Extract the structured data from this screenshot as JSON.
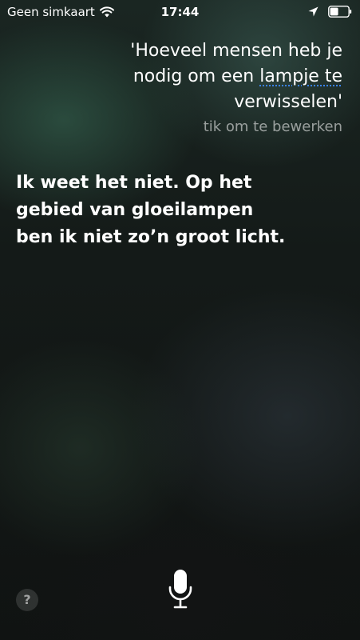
{
  "status_bar": {
    "carrier": "Geen simkaart",
    "time": "17:44"
  },
  "query": {
    "line1": "'Hoeveel mensen heb je",
    "line2_before": "nodig om een ",
    "line2_underlined": "lampje te",
    "line3": "verwisselen'",
    "edit_hint": "tik om te bewerken"
  },
  "answer": {
    "line1": "Ik weet het niet. Op het",
    "line2": "gebied van gloeilampen",
    "line3": "ben ik niet zo’n groot licht."
  },
  "bottom": {
    "help_label": "?"
  },
  "icons": {
    "wifi": "wifi-icon",
    "location": "location-arrow-icon",
    "battery": "battery-icon",
    "microphone": "microphone-icon"
  },
  "colors": {
    "underline_accent": "#3b82f6",
    "hint_text": "#9ca3a0"
  }
}
